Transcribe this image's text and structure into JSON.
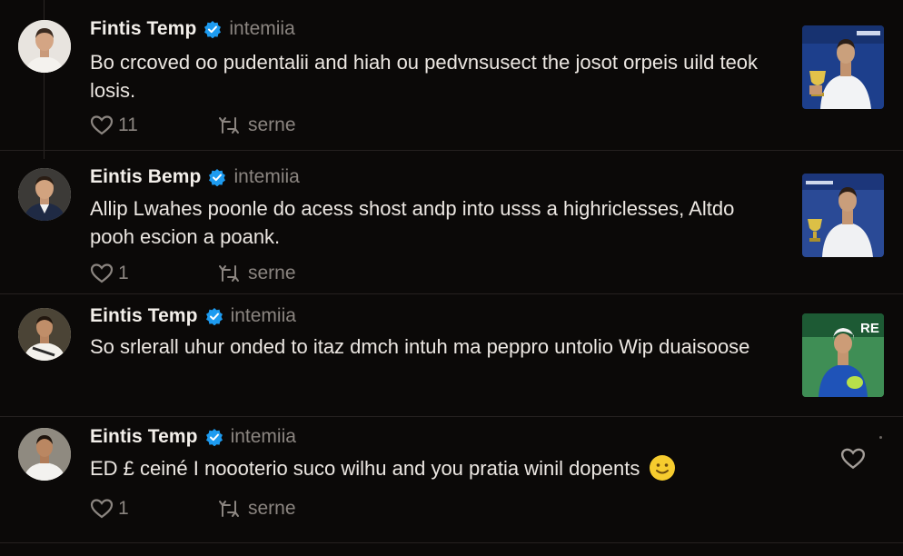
{
  "posts": [
    {
      "author": "Fintis Temp",
      "handle": "intemiia",
      "text": "Bo crcoved oo pudentalii and hiah ou pedvnsusect the josot orpeis uild teok losis.",
      "likes": "11",
      "share_label": "serne"
    },
    {
      "author": "Eintis Bemp",
      "handle": "intemiia",
      "text": "Allip Lwahes poonle do acess shost andp into usss a highriclesses, Altdo pooh escion a poank.",
      "likes": "1",
      "share_label": "serne"
    },
    {
      "author": "Eintis Temp",
      "handle": "intemiia",
      "text": "So srlerall uhur onded to itaz dmch intuh ma peppro untolio Wip duaisoose",
      "thumb_sign": "RE"
    },
    {
      "author": "Eintis Temp",
      "handle": "intemiia",
      "text": "ED £ ceiné I noooterio suco wilhu and you pratia winil dopents",
      "likes": "1",
      "share_label": "serne"
    }
  ],
  "colors": {
    "background": "#0b0908",
    "verified": "#1d9bf0",
    "muted": "#8b8580",
    "text": "#ece7e2"
  },
  "icons": {
    "verified": "verified-badge-icon",
    "like": "heart-icon",
    "share": "repost-icon",
    "emoji": "smile-emoji-icon"
  }
}
